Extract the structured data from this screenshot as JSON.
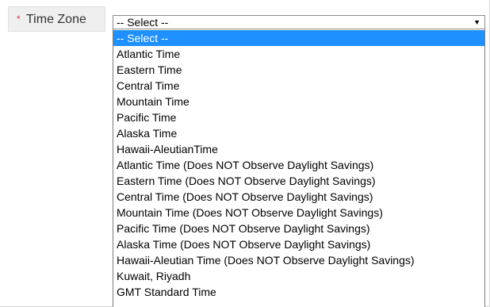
{
  "form": {
    "required_marker": "*",
    "field_label": "Time Zone"
  },
  "select": {
    "value": "-- Select --",
    "arrow_icon": "dropdown-triangle-icon"
  },
  "dropdown": {
    "options": [
      "-- Select --",
      "Atlantic Time",
      "Eastern Time",
      "Central Time",
      "Mountain Time",
      "Pacific Time",
      "Alaska Time",
      "Hawaii-AleutianTime",
      "Atlantic Time (Does NOT Observe Daylight Savings)",
      "Eastern Time (Does NOT Observe Daylight Savings)",
      "Central Time (Does NOT Observe Daylight Savings)",
      "Mountain Time (Does NOT Observe Daylight Savings)",
      "Pacific Time (Does NOT Observe Daylight Savings)",
      "Alaska Time (Does NOT Observe Daylight Savings)",
      "Hawaii-Aleutian Time (Does NOT Observe Daylight Savings)",
      "Kuwait, Riyadh",
      "GMT Standard Time"
    ],
    "highlighted_option": "-- Select --",
    "highlight_color": "#1e90ff"
  }
}
